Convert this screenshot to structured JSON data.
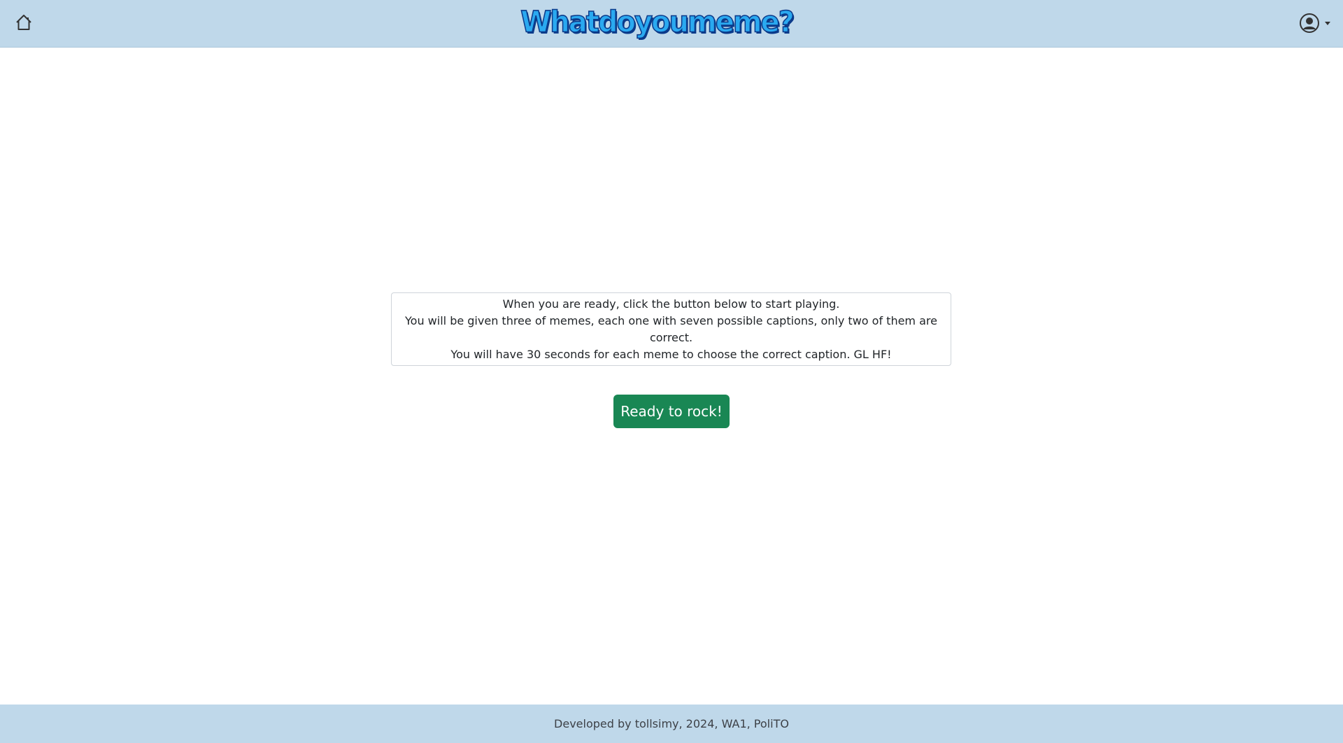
{
  "header": {
    "logo_text": "Whatdoyoumeme?",
    "home_icon": "home-icon",
    "user_icon": "user-circle-icon",
    "user_menu_caret": "caret-down-icon"
  },
  "main": {
    "instructions": [
      "When you are ready, click the button below to start playing.",
      "You will be given three of memes, each one with seven possible captions, only two of them are correct.",
      "You will have 30 seconds for each meme to choose the correct caption. GL HF!"
    ],
    "start_button_label": "Ready to rock!"
  },
  "footer": {
    "text": "Developed by tollsimy, 2024, WA1, PoliTO"
  },
  "colors": {
    "navbar_bg": "#bfd8ea",
    "button_bg": "#198754",
    "logo_fill": "#2aa9f0",
    "logo_outline": "#0b3a8a"
  }
}
